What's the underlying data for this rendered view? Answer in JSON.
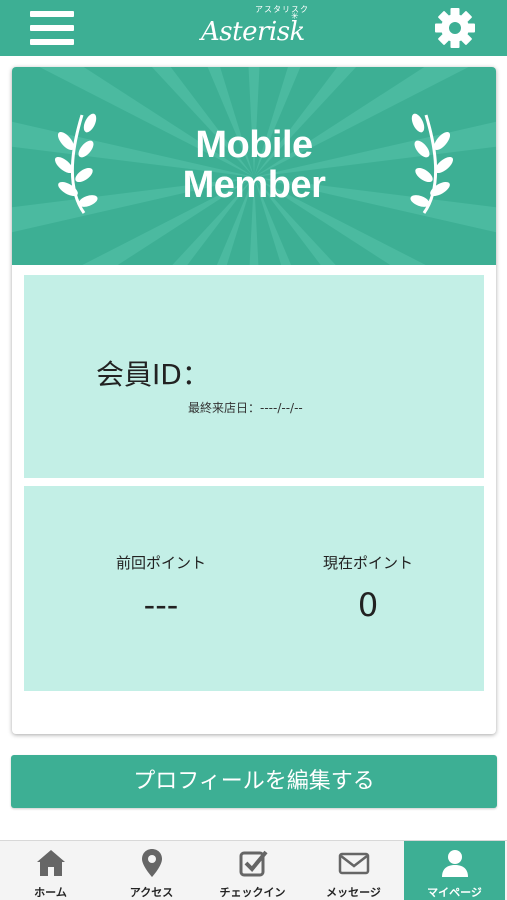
{
  "header": {
    "logo_kana": "アスタリスク",
    "logo_text": "Asterisk",
    "logo_star": "✳"
  },
  "banner": {
    "title_line1": "Mobile",
    "title_line2": "Member"
  },
  "member": {
    "id_label": "会員ID：",
    "last_visit_label": "最終来店日：",
    "last_visit_value": "----/--/--"
  },
  "points": {
    "previous_label": "前回ポイント",
    "previous_value": "---",
    "current_label": "現在ポイント",
    "current_value": "0"
  },
  "edit_profile_label": "プロフィールを編集する",
  "tabs": [
    {
      "label": "ホーム",
      "icon": "home-icon",
      "active": false
    },
    {
      "label": "アクセス",
      "icon": "map-pin-icon",
      "active": false
    },
    {
      "label": "チェックイン",
      "icon": "checkin-icon",
      "active": false
    },
    {
      "label": "メッセージ",
      "icon": "envelope-icon",
      "active": false
    },
    {
      "label": "マイページ",
      "icon": "user-icon",
      "active": true
    }
  ],
  "colors": {
    "primary": "#3daf94",
    "panel": "#c3efe6"
  }
}
